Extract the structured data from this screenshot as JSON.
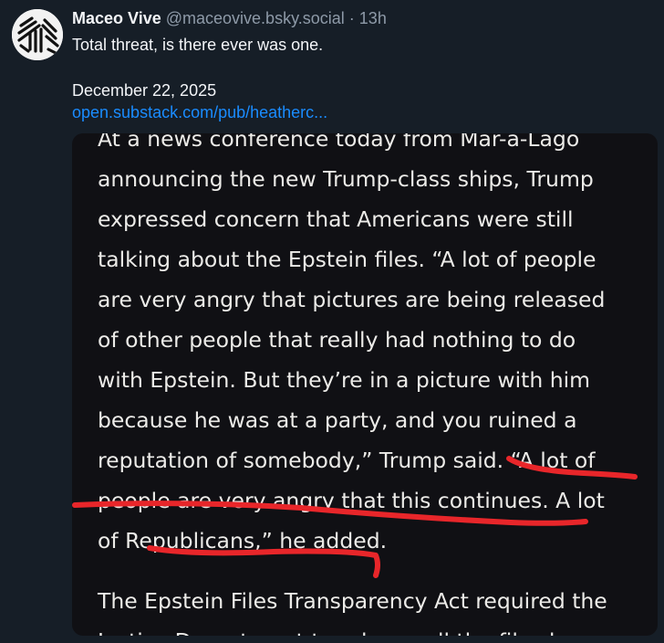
{
  "post": {
    "author_name": "Maceo Vive",
    "handle": "@maceovive.bsky.social",
    "separator": "·",
    "time_ago": "13h",
    "text": "Total threat, is there ever was one.",
    "date": "December 22, 2025",
    "link_text": "open.substack.com/pub/heatherc..."
  },
  "embed": {
    "lines": [
      "At a news conference today from Mar-a-Lago",
      "announcing the new Trump-class ships, Trump",
      "expressed concern that Americans were still",
      "talking about the Epstein files. “A lot of people",
      "are very angry that pictures are being released",
      "of other people that really had nothing to do",
      "with Epstein. But they’re in a picture with him",
      "because he was at a party, and you ruined a",
      "reputation of somebody,” Trump said. “A lot of",
      "people are very angry that this continues. A lot",
      "of Republicans,” he added."
    ],
    "next_paragraph": [
      "The Epstein Files Transparency Act required the",
      "Justice Department to release all the files by"
    ],
    "annotation_color": "#e8262a"
  },
  "colors": {
    "background": "#161e27",
    "link": "#1a8cff"
  }
}
